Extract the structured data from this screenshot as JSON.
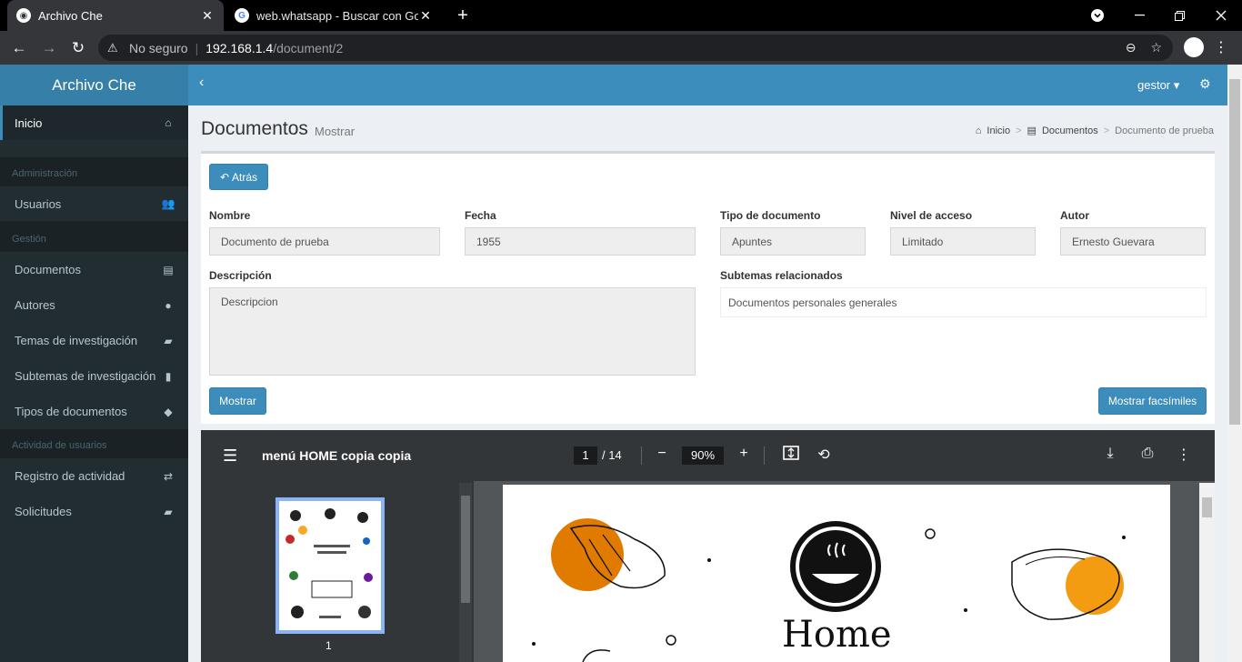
{
  "browser": {
    "tabs": [
      {
        "title": "Archivo Che",
        "close": "✕"
      },
      {
        "title": "web.whatsapp - Buscar con Goog",
        "close": "✕"
      }
    ],
    "new_tab": "+",
    "address": {
      "security_label": "No seguro",
      "host": "192.168.1.4",
      "path": "/document/2"
    }
  },
  "app": {
    "brand": "Archivo Che",
    "user_menu": "gestor ▾"
  },
  "sidebar": {
    "items": [
      {
        "label": "Inicio",
        "icon": "home-icon",
        "active": true
      },
      {
        "header": "Administración"
      },
      {
        "label": "Usuarios",
        "icon": "users-icon"
      },
      {
        "header": "Gestión"
      },
      {
        "label": "Documentos",
        "icon": "file-icon"
      },
      {
        "label": "Autores",
        "icon": "user-icon"
      },
      {
        "label": "Temas de investigación",
        "icon": "book-icon"
      },
      {
        "label": "Subtemas de investigación",
        "icon": "bookmark-icon"
      },
      {
        "label": "Tipos de documentos",
        "icon": "tags-icon"
      },
      {
        "header": "Actividad de usuarios"
      },
      {
        "label": "Registro de actividad",
        "icon": "exchange-icon"
      },
      {
        "label": "Solicitudes",
        "icon": "book-icon"
      }
    ]
  },
  "header": {
    "title": "Documentos",
    "subtitle": "Mostrar",
    "breadcrumb": [
      "Inicio",
      "Documentos",
      "Documento de prueba"
    ]
  },
  "form": {
    "back_button": "Atrás",
    "nombre_label": "Nombre",
    "nombre_value": "Documento de prueba",
    "fecha_label": "Fecha",
    "fecha_value": "1955",
    "tipo_label": "Tipo de documento",
    "tipo_value": "Apuntes",
    "nivel_label": "Nivel de acceso",
    "nivel_value": "Limitado",
    "autor_label": "Autor",
    "autor_value": "Ernesto Guevara",
    "descripcion_label": "Descripción",
    "descripcion_value": "Descripcion",
    "subtemas_label": "Subtemas relacionados",
    "subtemas_value": "Documentos personales generales",
    "show_button": "Mostrar",
    "facsimiles_button": "Mostrar facsímiles"
  },
  "pdf": {
    "title": "menú HOME copia copia",
    "page_current": "1",
    "page_total": "/ 14",
    "zoom": "90%",
    "thumbnail_number": "1",
    "page_logo_text": "Home"
  }
}
